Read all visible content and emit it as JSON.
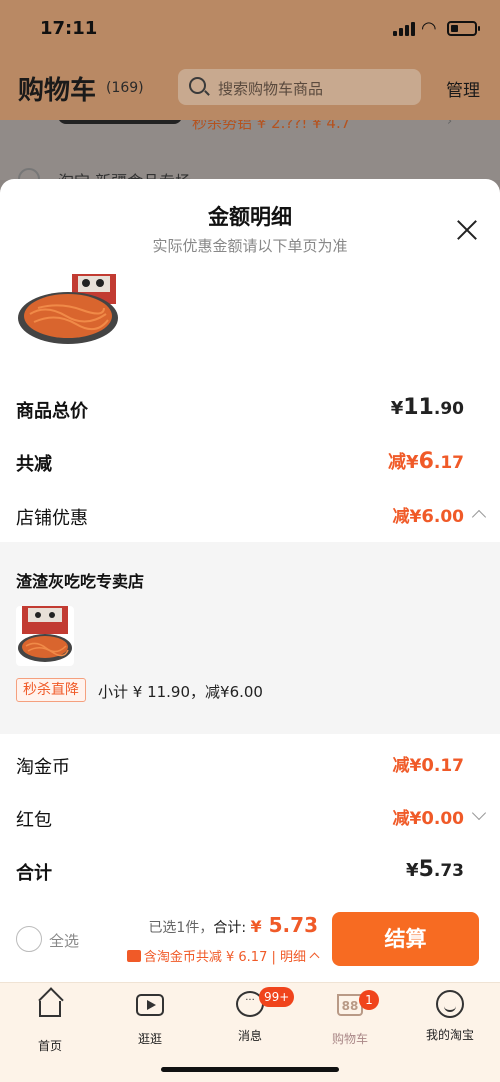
{
  "status_bar": {
    "time": "17:11"
  },
  "header": {
    "title": "购物车",
    "count": "(169)",
    "search_placeholder": "搜索购物车商品",
    "manage": "管理"
  },
  "background": {
    "promo_text": "秒杀势铝 ¥ 2.??! ¥ 4.7",
    "shop_text": "淘宝 新疆食品专场"
  },
  "sheet": {
    "title": "金额明细",
    "subtitle": "实际优惠金额请以下单页为准",
    "rows": {
      "total": {
        "label": "商品总价",
        "currency": "¥",
        "int": "11",
        "dec": ".90"
      },
      "discount": {
        "label": "共减",
        "prefix": "减",
        "currency": "¥",
        "int": "6",
        "dec": ".17"
      },
      "shop_discount": {
        "label": "店铺优惠",
        "prefix": "减",
        "currency": "¥",
        "int": "6",
        "dec": ".00"
      },
      "coin": {
        "label": "淘金币",
        "prefix": "减",
        "currency": "¥",
        "int": "0",
        "dec": ".17"
      },
      "redpacket": {
        "label": "红包",
        "prefix": "减",
        "currency": "¥",
        "int": "0",
        "dec": ".00"
      },
      "sum": {
        "label": "合计",
        "currency": "¥",
        "int": "5",
        "dec": ".73"
      }
    },
    "shop": {
      "name": "渣渣灰吃吃专卖店",
      "promo_tag": "秒杀直降",
      "subtotal": "小计 ¥ 11.90，减¥6.00"
    }
  },
  "checkout": {
    "select_all": "全选",
    "selected": "已选1件，",
    "total_label": "合计:",
    "currency": "¥",
    "total": "5.73",
    "coin_note": "含淘金币共减 ¥ 6.17 | 明细",
    "pay_button": "结算"
  },
  "tabbar": {
    "items": [
      {
        "label": "首页",
        "icon": "home-icon"
      },
      {
        "label": "逛逛",
        "icon": "play-icon"
      },
      {
        "label": "消息",
        "icon": "message-icon",
        "badge": "99+"
      },
      {
        "label": "购物车",
        "icon": "cart-icon",
        "badge": "1",
        "icon_text": "88"
      },
      {
        "label": "我的淘宝",
        "icon": "smile-icon"
      }
    ]
  },
  "colors": {
    "accent": "#f05a28",
    "button": "#f76b22",
    "tabbar_bg": "#fdf3e8"
  }
}
